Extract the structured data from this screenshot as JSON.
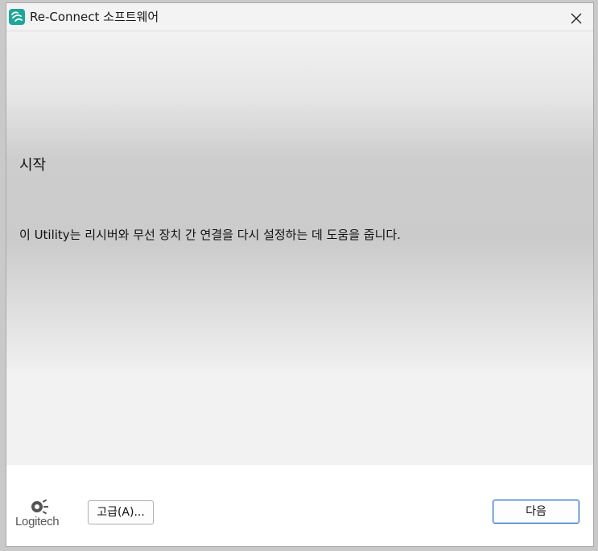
{
  "window": {
    "title": "Re-Connect 소프트웨어",
    "app_icon": "logitech-reconnect-icon",
    "close_icon": "close-icon"
  },
  "main": {
    "heading": "시작",
    "description": "이 Utility는 리시버와 무선 장치 간 연결을 다시 설정하는 데 도움을 줍니다."
  },
  "footer": {
    "logo_text": "Logitech",
    "advanced_button_label": "고급(A)...",
    "next_button_label": "다음"
  },
  "colors": {
    "app_icon_bg": "#1fa69a",
    "next_button_border": "#2b6fc4"
  }
}
